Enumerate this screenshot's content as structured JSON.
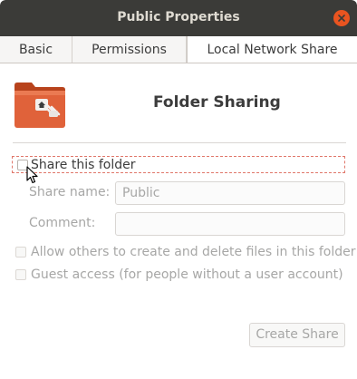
{
  "window": {
    "title": "Public Properties"
  },
  "tabs": [
    {
      "label": "Basic",
      "active": false
    },
    {
      "label": "Permissions",
      "active": false
    },
    {
      "label": "Local Network Share",
      "active": true
    }
  ],
  "sharing": {
    "heading": "Folder Sharing",
    "share_checkbox_label": "Share this folder",
    "share_checked": false,
    "share_name_label": "Share name:",
    "share_name_value": "Public",
    "comment_label": "Comment:",
    "comment_value": "",
    "allow_others_label": "Allow others to create and delete files in this folder",
    "guest_access_label": "Guest access (for people without a user account)",
    "create_button_label": "Create Share"
  },
  "icons": {
    "close": "close-icon",
    "folder": "folder-share-icon",
    "cursor": "mouse-pointer-icon"
  },
  "colors": {
    "titlebar": "#3b3b38",
    "close_button": "#e95420",
    "folder": "#d65a2c"
  }
}
